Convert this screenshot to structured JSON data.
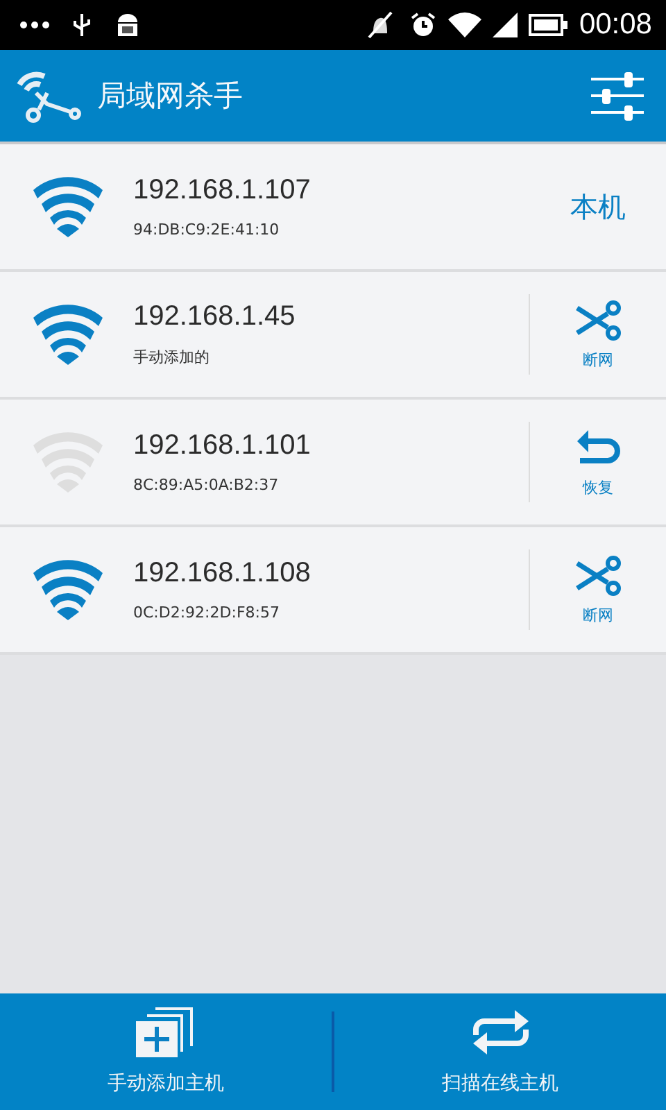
{
  "status_bar": {
    "time": "00:08"
  },
  "app_bar": {
    "title": "局域网杀手"
  },
  "hosts": [
    {
      "ip": "192.168.1.107",
      "detail": "94:DB:C9:2E:41:10",
      "online": true,
      "action": {
        "kind": "self",
        "label": "本机"
      }
    },
    {
      "ip": "192.168.1.45",
      "detail": "手动添加的",
      "online": true,
      "action": {
        "kind": "cut",
        "label": "断网"
      }
    },
    {
      "ip": "192.168.1.101",
      "detail": "8C:89:A5:0A:B2:37",
      "online": false,
      "action": {
        "kind": "restore",
        "label": "恢复"
      }
    },
    {
      "ip": "192.168.1.108",
      "detail": "0C:D2:92:2D:F8:57",
      "online": true,
      "action": {
        "kind": "cut",
        "label": "断网"
      }
    }
  ],
  "bottom_bar": [
    {
      "kind": "add",
      "label": "手动添加主机"
    },
    {
      "kind": "scan",
      "label": "扫描在线主机"
    }
  ]
}
